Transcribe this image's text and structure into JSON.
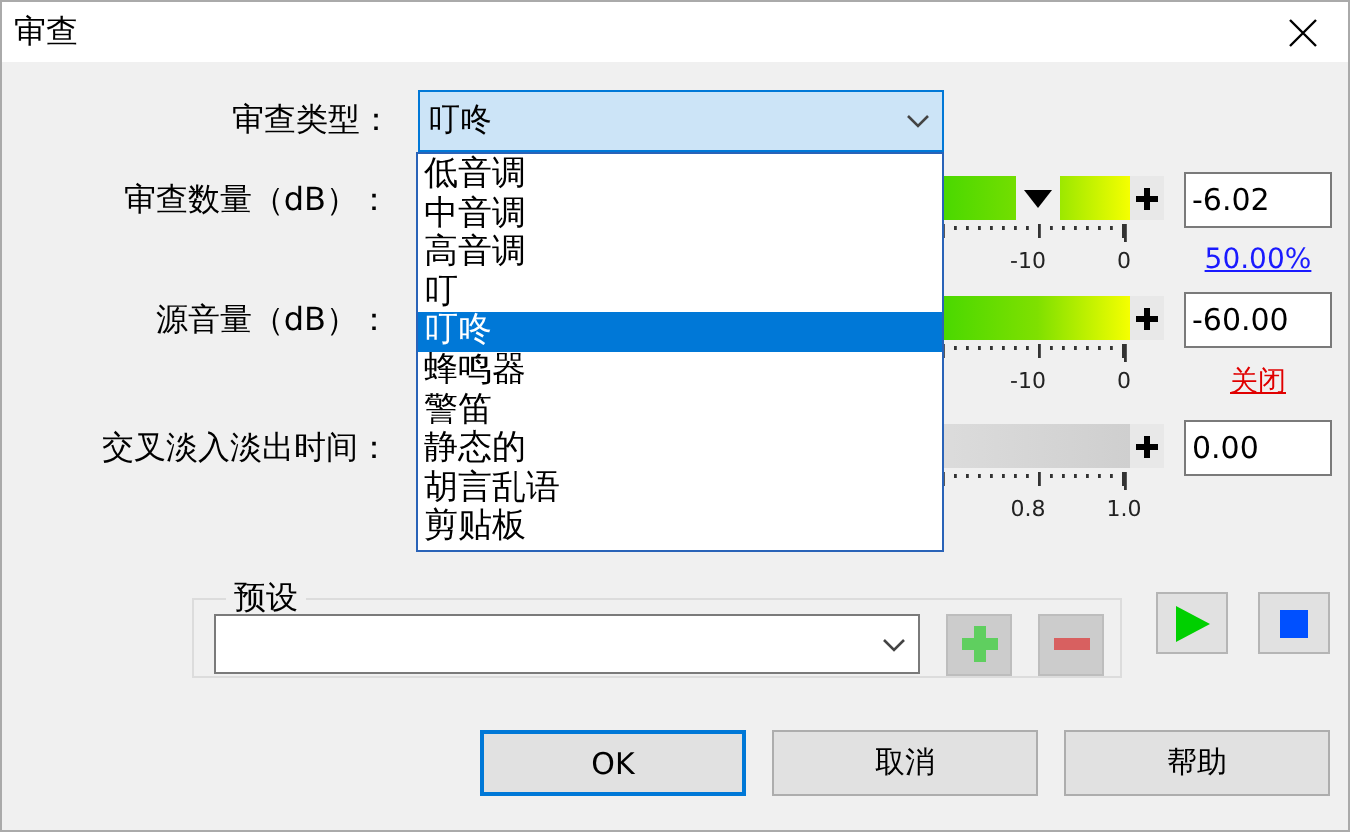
{
  "window": {
    "title": "审查"
  },
  "type_field": {
    "label": "审查类型：",
    "value": "叮咚",
    "expanded": true,
    "options": [
      {
        "label": "低音调",
        "selected": false
      },
      {
        "label": "中音调",
        "selected": false
      },
      {
        "label": "高音调",
        "selected": false
      },
      {
        "label": "叮",
        "selected": false
      },
      {
        "label": "叮咚",
        "selected": true
      },
      {
        "label": "蜂鸣器",
        "selected": false
      },
      {
        "label": "警笛",
        "selected": false
      },
      {
        "label": "静态的",
        "selected": false
      },
      {
        "label": "胡言乱语",
        "selected": false
      },
      {
        "label": "剪贴板",
        "selected": false
      }
    ]
  },
  "sliders": [
    {
      "kind": "gain",
      "label": "审查数量（dB）：",
      "level": 0.87,
      "ticks": [
        "-10",
        "0"
      ],
      "value": "-6.02",
      "note": {
        "kind": "link",
        "text": "50.00%"
      }
    },
    {
      "kind": "gain",
      "label": "源音量（dB）：",
      "ticks": [
        "-10",
        "0"
      ],
      "value": "-60.00",
      "note": {
        "kind": "warning",
        "text": "关闭"
      }
    },
    {
      "kind": "time",
      "label": "交叉淡入淡出时间：",
      "ticks": [
        "0.8",
        "1.0"
      ],
      "value": "0.00"
    }
  ],
  "presets": {
    "title": "预设"
  },
  "buttons": [
    {
      "label": "OK",
      "default": true
    },
    {
      "label": "取消",
      "default": false
    },
    {
      "label": "帮助",
      "default": false
    }
  ]
}
